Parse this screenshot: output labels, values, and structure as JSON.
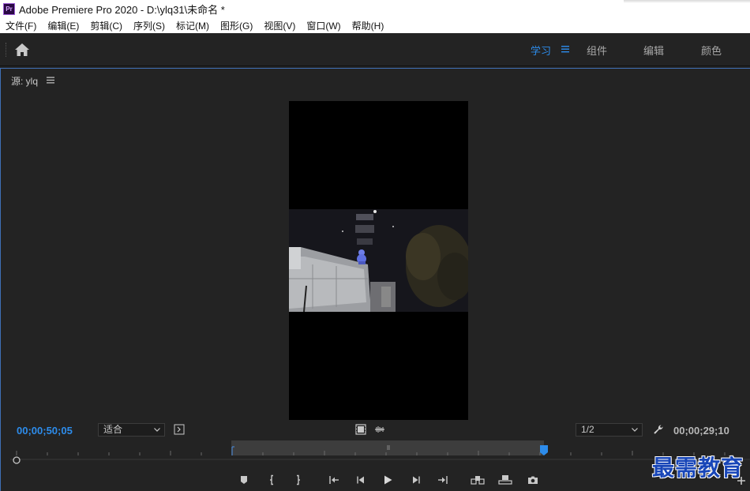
{
  "window": {
    "title": "Adobe Premiere Pro 2020 - D:\\ylq31\\未命名 *",
    "app_icon_text": "Pr"
  },
  "menu": [
    "文件(F)",
    "编辑(E)",
    "剪辑(C)",
    "序列(S)",
    "标记(M)",
    "图形(G)",
    "视图(V)",
    "窗口(W)",
    "帮助(H)"
  ],
  "workspaces": {
    "learn": "学习",
    "assembly": "组件",
    "editing": "编辑",
    "color": "颜色",
    "active_color": "#2d8ceb"
  },
  "source_panel": {
    "title": "源: ylq"
  },
  "controls": {
    "current_timecode": "00;00;50;05",
    "duration_timecode": "00;00;29;10",
    "zoom_select": "适合",
    "resolution_select": "1/2"
  },
  "icons": [
    "home-icon",
    "hamburger-menu-icon",
    "export-frame-icon",
    "insert-icon",
    "overwrite-icon",
    "play-icon",
    "wrench-icon"
  ],
  "watermark": "最需教育"
}
